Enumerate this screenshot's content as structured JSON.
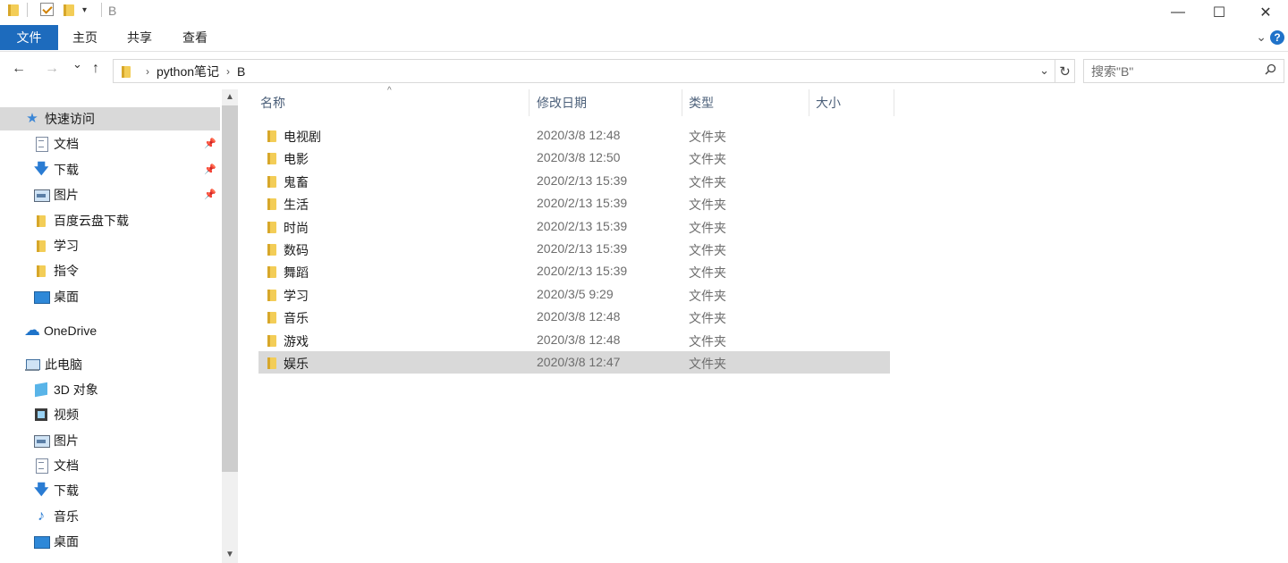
{
  "window": {
    "title": "B",
    "minimize": "—",
    "maximize": "☐",
    "close": "✕"
  },
  "ribbon": {
    "tabs": [
      "文件",
      "主页",
      "共享",
      "查看"
    ],
    "expand_icon": "chevron-down-icon",
    "help": "?"
  },
  "navigation": {
    "back": "←",
    "forward": "→",
    "recent": "⌄",
    "up": "↑",
    "breadcrumb": [
      "python笔记",
      "B"
    ],
    "dropdown": "⌄",
    "refresh": "↻"
  },
  "search": {
    "placeholder": "搜索\"B\""
  },
  "sidebar": {
    "quick_access": "快速访问",
    "quick_items": [
      {
        "label": "文档",
        "icon": "document-icon",
        "pinned": true
      },
      {
        "label": "下载",
        "icon": "download-icon",
        "pinned": true
      },
      {
        "label": "图片",
        "icon": "pictures-icon",
        "pinned": true
      },
      {
        "label": "百度云盘下载",
        "icon": "folder-icon",
        "pinned": false
      },
      {
        "label": "学习",
        "icon": "folder-icon",
        "pinned": false
      },
      {
        "label": "指令",
        "icon": "folder-icon",
        "pinned": false
      },
      {
        "label": "桌面",
        "icon": "desktop-icon",
        "pinned": false
      }
    ],
    "onedrive": "OneDrive",
    "this_pc": "此电脑",
    "pc_items": [
      {
        "label": "3D 对象",
        "icon": "3d-objects-icon"
      },
      {
        "label": "视频",
        "icon": "video-icon"
      },
      {
        "label": "图片",
        "icon": "pictures-icon"
      },
      {
        "label": "文档",
        "icon": "document-icon"
      },
      {
        "label": "下载",
        "icon": "download-icon"
      },
      {
        "label": "音乐",
        "icon": "music-icon"
      },
      {
        "label": "桌面",
        "icon": "desktop-icon"
      }
    ]
  },
  "columns": {
    "name": "名称",
    "date": "修改日期",
    "type": "类型",
    "size": "大小"
  },
  "files": [
    {
      "name": "电视剧",
      "date": "2020/3/8 12:48",
      "type": "文件夹"
    },
    {
      "name": "电影",
      "date": "2020/3/8 12:50",
      "type": "文件夹"
    },
    {
      "name": "鬼畜",
      "date": "2020/2/13 15:39",
      "type": "文件夹"
    },
    {
      "name": "生活",
      "date": "2020/2/13 15:39",
      "type": "文件夹"
    },
    {
      "name": "时尚",
      "date": "2020/2/13 15:39",
      "type": "文件夹"
    },
    {
      "name": "数码",
      "date": "2020/2/13 15:39",
      "type": "文件夹"
    },
    {
      "name": "舞蹈",
      "date": "2020/2/13 15:39",
      "type": "文件夹"
    },
    {
      "name": "学习",
      "date": "2020/3/5 9:29",
      "type": "文件夹"
    },
    {
      "name": "音乐",
      "date": "2020/3/8 12:48",
      "type": "文件夹"
    },
    {
      "name": "游戏",
      "date": "2020/3/8 12:48",
      "type": "文件夹"
    },
    {
      "name": "娱乐",
      "date": "2020/3/8 12:47",
      "type": "文件夹",
      "selected": true
    }
  ],
  "colors": {
    "accent": "#1d6bbd",
    "selection": "#d9d9d9",
    "folder": "#f3cd57"
  }
}
